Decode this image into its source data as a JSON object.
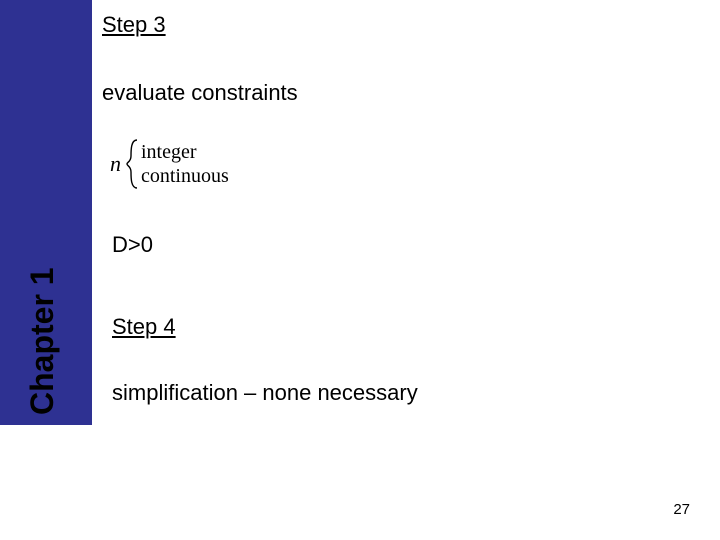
{
  "sidebar": {
    "chapter_label": "Chapter 1"
  },
  "content": {
    "step3_heading": "Step 3",
    "evaluate_text": "evaluate constraints",
    "formula": {
      "var": "n",
      "case_top": "integer",
      "case_bottom": "continuous"
    },
    "d_constraint": "D>0",
    "step4_heading": "Step 4",
    "simplification_text": "simplification – none necessary"
  },
  "page_number": "27"
}
